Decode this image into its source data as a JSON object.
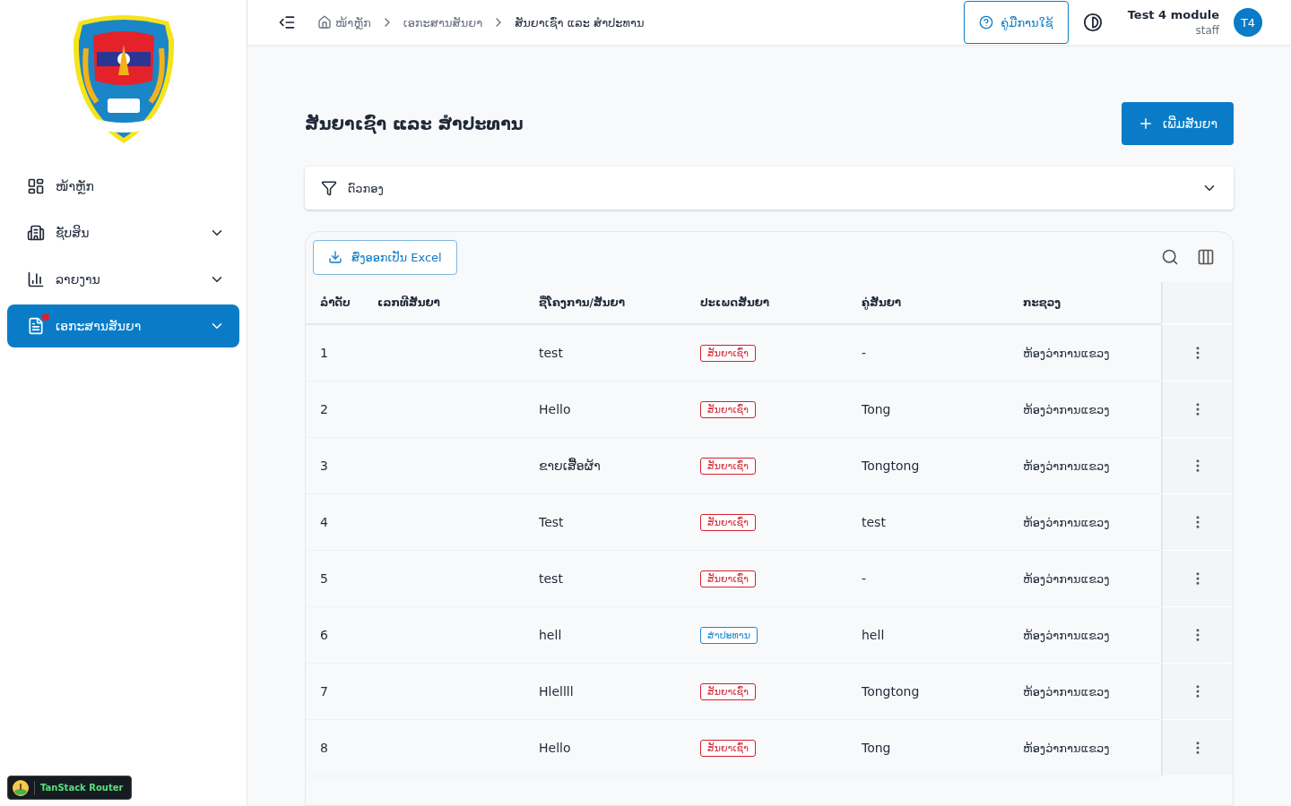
{
  "sidebar": {
    "items": [
      {
        "label": "ໜ້າຫຼັກ",
        "expandable": false,
        "selected": false,
        "badge": false
      },
      {
        "label": "ຊັບສິນ",
        "expandable": true,
        "selected": false,
        "badge": false
      },
      {
        "label": "ລາຍງານ",
        "expandable": true,
        "selected": false,
        "badge": false
      },
      {
        "label": "ເອກະສານສັນຍາ",
        "expandable": true,
        "selected": true,
        "badge": true
      }
    ],
    "devtools": "TanStack Router"
  },
  "header": {
    "breadcrumbs": [
      {
        "label": "ໜ້າຫຼັກ",
        "home": true
      },
      {
        "label": "ເອກະສານສັນຍາ",
        "home": false
      },
      {
        "label": "ສັນຍາເຊົ່າ ແລະ ສຳປະທານ",
        "home": false
      }
    ],
    "help_button": "ຄູ່ມືການໃຊ້",
    "user": {
      "name": "Test 4 module",
      "role": "staff",
      "initials": "T4"
    }
  },
  "page": {
    "title": "ສັນຍາເຊົ່າ ແລະ ສຳປະທານ",
    "add_button": "ເພີ່ມສັນຍາ",
    "filter": {
      "label": "ຕົວກອງ",
      "expanded": false
    },
    "export_button": "ສົ່ງອອກເປັນ Excel",
    "table": {
      "columns": [
        "ລຳດັບ",
        "ເລກທີສັນຍາ",
        "ຊື່ໂຄງການ/ສັນຍາ",
        "ປະເພດສັນຍາ",
        "ຄູ່ສັນຍາ",
        "ກະຊວງ"
      ],
      "rows": [
        {
          "no": "1",
          "name": "test",
          "type": {
            "label": "ສັນຍາເຊົ່າ",
            "kind": "lease"
          },
          "partner": "-",
          "ministry": "ຫ້ອງວ່າການແຂວງ"
        },
        {
          "no": "2",
          "name": "Hello",
          "type": {
            "label": "ສັນຍາເຊົ່າ",
            "kind": "lease"
          },
          "partner": "Tong",
          "ministry": "ຫ້ອງວ່າການແຂວງ"
        },
        {
          "no": "3",
          "name": "ຂາຍເສື້ອຜ້າ",
          "type": {
            "label": "ສັນຍາເຊົ່າ",
            "kind": "lease"
          },
          "partner": "Tongtong",
          "ministry": "ຫ້ອງວ່າການແຂວງ"
        },
        {
          "no": "4",
          "name": "Test",
          "type": {
            "label": "ສັນຍາເຊົ່າ",
            "kind": "lease"
          },
          "partner": "test",
          "ministry": "ຫ້ອງວ່າການແຂວງ"
        },
        {
          "no": "5",
          "name": "test",
          "type": {
            "label": "ສັນຍາເຊົ່າ",
            "kind": "lease"
          },
          "partner": "-",
          "ministry": "ຫ້ອງວ່າການແຂວງ"
        },
        {
          "no": "6",
          "name": "hell",
          "type": {
            "label": "ສຳປະທານ",
            "kind": "concession"
          },
          "partner": "hell",
          "ministry": "ຫ້ອງວ່າການແຂວງ"
        },
        {
          "no": "7",
          "name": "Hlellll",
          "type": {
            "label": "ສັນຍາເຊົ່າ",
            "kind": "lease"
          },
          "partner": "Tongtong",
          "ministry": "ຫ້ອງວ່າການແຂວງ"
        },
        {
          "no": "8",
          "name": "Hello",
          "type": {
            "label": "ສັນຍາເຊົ່າ",
            "kind": "lease"
          },
          "partner": "Tong",
          "ministry": "ຫ້ອງວ່າການແຂວງ"
        }
      ]
    }
  }
}
